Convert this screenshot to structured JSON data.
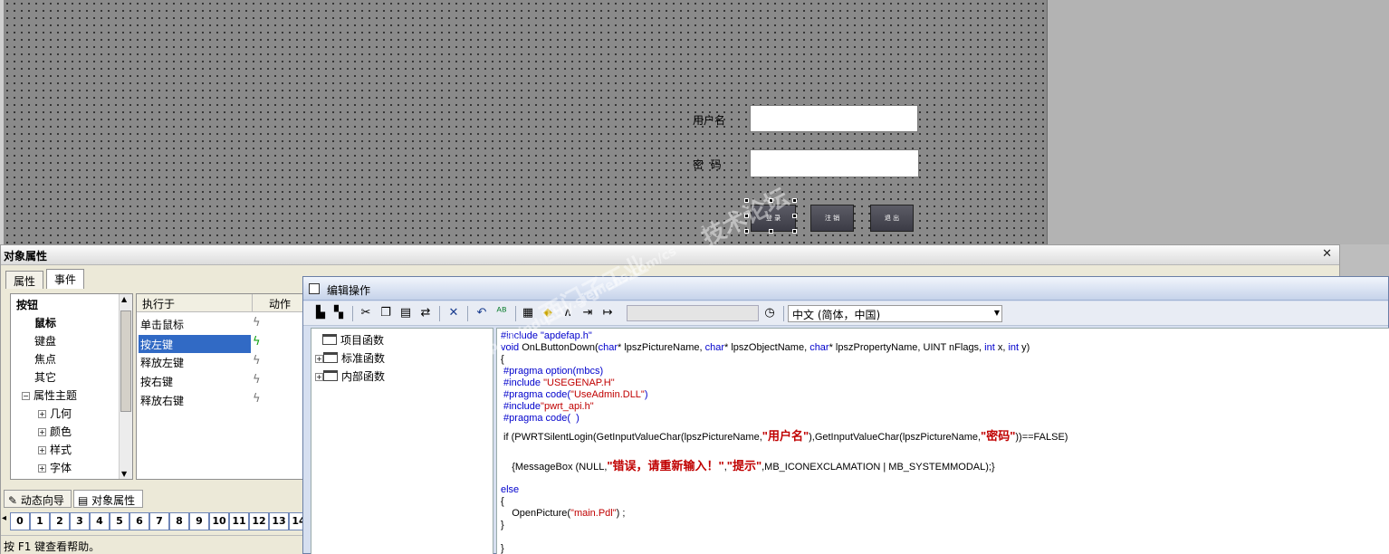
{
  "canvas": {
    "username_label": "用户名",
    "password_label": "密  码",
    "buttons": [
      "登 录",
      "注 销",
      "退 出"
    ]
  },
  "prop_panel": {
    "title": "对象属性",
    "close": "✕",
    "tabs": [
      "属性",
      "事件"
    ],
    "tree": {
      "root": "按钮",
      "items": [
        "鼠标",
        "键盘",
        "焦点",
        "其它",
        "属性主题"
      ],
      "sub_items": [
        "几何",
        "颜色",
        "样式",
        "字体"
      ]
    },
    "events": {
      "col_exec": "执行于",
      "col_action": "动作",
      "rows": [
        "单击鼠标",
        "按左键",
        "释放左键",
        "按右键",
        "释放右键"
      ]
    },
    "bottom_tabs": [
      "动态向导",
      "对象属性"
    ],
    "ruler": [
      "0",
      "1",
      "2",
      "3",
      "4",
      "5",
      "6",
      "7",
      "8",
      "9",
      "10",
      "11",
      "12",
      "13",
      "14"
    ],
    "status": "按 F1 键查看帮助。"
  },
  "edit_dialog": {
    "title": "编辑操作",
    "language": "中文 (简体，中国)",
    "func_tree": [
      "项目函数",
      "标准函数",
      "内部函数"
    ],
    "code": {
      "l1": "#include \"apdefap.h\"",
      "l2_kw1": "void",
      "l2_a": " OnLButtonDown(",
      "l2_kw2": "char",
      "l2_b": "* lpszPictureName, ",
      "l2_kw3": "char",
      "l2_c": "* lpszObjectName, ",
      "l2_kw4": "char",
      "l2_d": "* lpszPropertyName, UINT nFlags, ",
      "l2_kw5": "int",
      "l2_e": " x, ",
      "l2_kw6": "int",
      "l2_f": " y)",
      "l3": "{",
      "l4": " #pragma option(mbcs)",
      "l5a": " #include ",
      "l5b": "\"USEGENAP.H\"",
      "l6a": " #pragma code(",
      "l6b": "\"UseAdmin.DLL\"",
      "l6c": ")",
      "l7a": " #include",
      "l7b": "\"pwrt_api.h\"",
      "l8": " #pragma code(  )",
      "l9a": " if (PWRTSilentLogin(GetInputValueChar(lpszPictureName,",
      "l9b": "\"用户名\"",
      "l9c": "),GetInputValueChar(lpszPictureName,",
      "l9d": "\"密码\"",
      "l9e": "))==FALSE)",
      "l10a": "    {MessageBox (NULL,",
      "l10b": "\"错误，请重新输入！\"",
      "l10c": ",",
      "l10d": "\"提示\"",
      "l10e": ",MB_ICONEXCLAMATION | MB_SYSTEMMODAL);}",
      "l11": "else",
      "l12": "{",
      "l13a": "    OpenPicture(",
      "l13b": "\"main.Pdl\"",
      "l13c": ") ;",
      "l14": "}",
      "l15": "}"
    }
  },
  "watermark": {
    "line1": "技术论坛",
    "line2": "西门子工业",
    "line3": "support.industry.siemens.com/cs"
  }
}
